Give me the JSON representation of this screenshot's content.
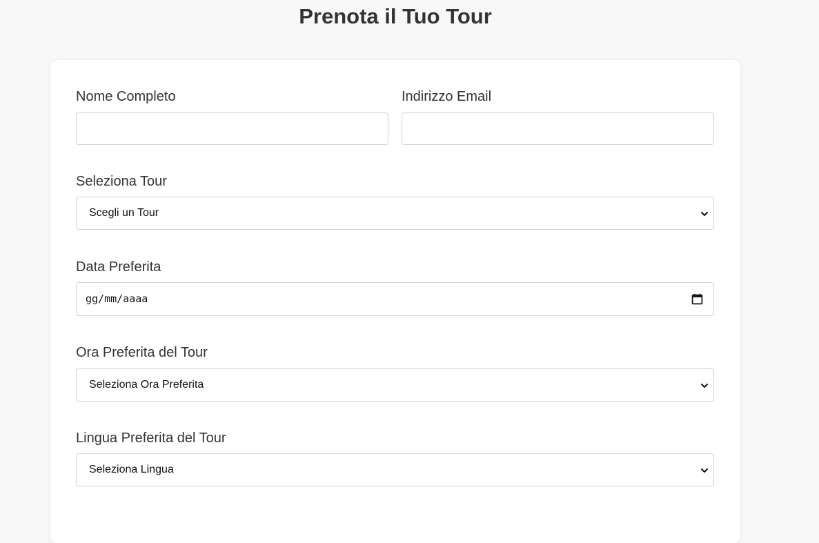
{
  "page": {
    "title": "Prenota il Tuo Tour"
  },
  "form": {
    "full_name": {
      "label": "Nome Completo",
      "value": ""
    },
    "email": {
      "label": "Indirizzo Email",
      "value": ""
    },
    "tour": {
      "label": "Seleziona Tour",
      "selected": "Scegli un Tour"
    },
    "date": {
      "label": "Data Preferita",
      "placeholder": "gg/mm/aaaa"
    },
    "time": {
      "label": "Ora Preferita del Tour",
      "selected": "Seleziona Ora Preferita"
    },
    "language": {
      "label": "Lingua Preferita del Tour",
      "selected": "Seleziona Lingua"
    }
  },
  "icons": {
    "select_arrow": "chevron-down-icon",
    "date_picker": "calendar-icon"
  }
}
